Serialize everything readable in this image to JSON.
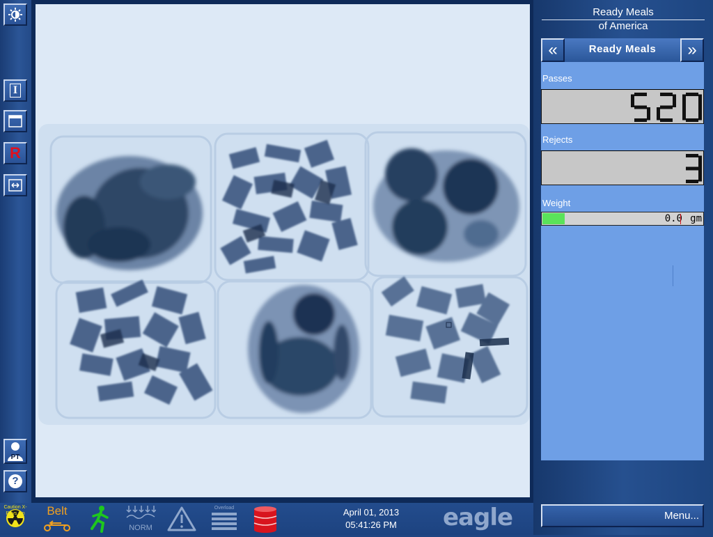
{
  "brand": {
    "line1": "Ready Meals",
    "line2": "of America"
  },
  "product": {
    "name": "Ready Meals",
    "prev_label": "«",
    "next_label": "»"
  },
  "counters": {
    "passes": {
      "label": "Passes",
      "value": "520"
    },
    "rejects": {
      "label": "Rejects",
      "value": "3"
    }
  },
  "weight": {
    "label": "Weight",
    "value": "0.0",
    "unit": "gm",
    "bar_fraction": 0.14
  },
  "menu": {
    "label": "Menu..."
  },
  "status": {
    "date": "April 01, 2013",
    "time": "05:41:26 PM",
    "belt_label": "Belt",
    "caution_label": "Caution X-Rays On",
    "norm_label": "NORM",
    "overload_label": "Overload",
    "logo_text": "eagle"
  },
  "left_tools": [
    {
      "name": "brightness-icon"
    },
    {
      "name": "info-icon",
      "glyph": "I"
    },
    {
      "name": "window-icon"
    },
    {
      "name": "reject-icon",
      "glyph": "R"
    },
    {
      "name": "fit-icon"
    },
    {
      "name": "user-icon",
      "glyph": "PT"
    },
    {
      "name": "help-icon",
      "glyph": "?"
    }
  ],
  "colors": {
    "panel_blue": "#6e9fe6",
    "accent_red": "#e0101e",
    "weight_green": "#5ae35a",
    "belt_orange": "#f0a020",
    "running_green": "#1ec81e",
    "caution_yellow": "#f2e21a"
  }
}
